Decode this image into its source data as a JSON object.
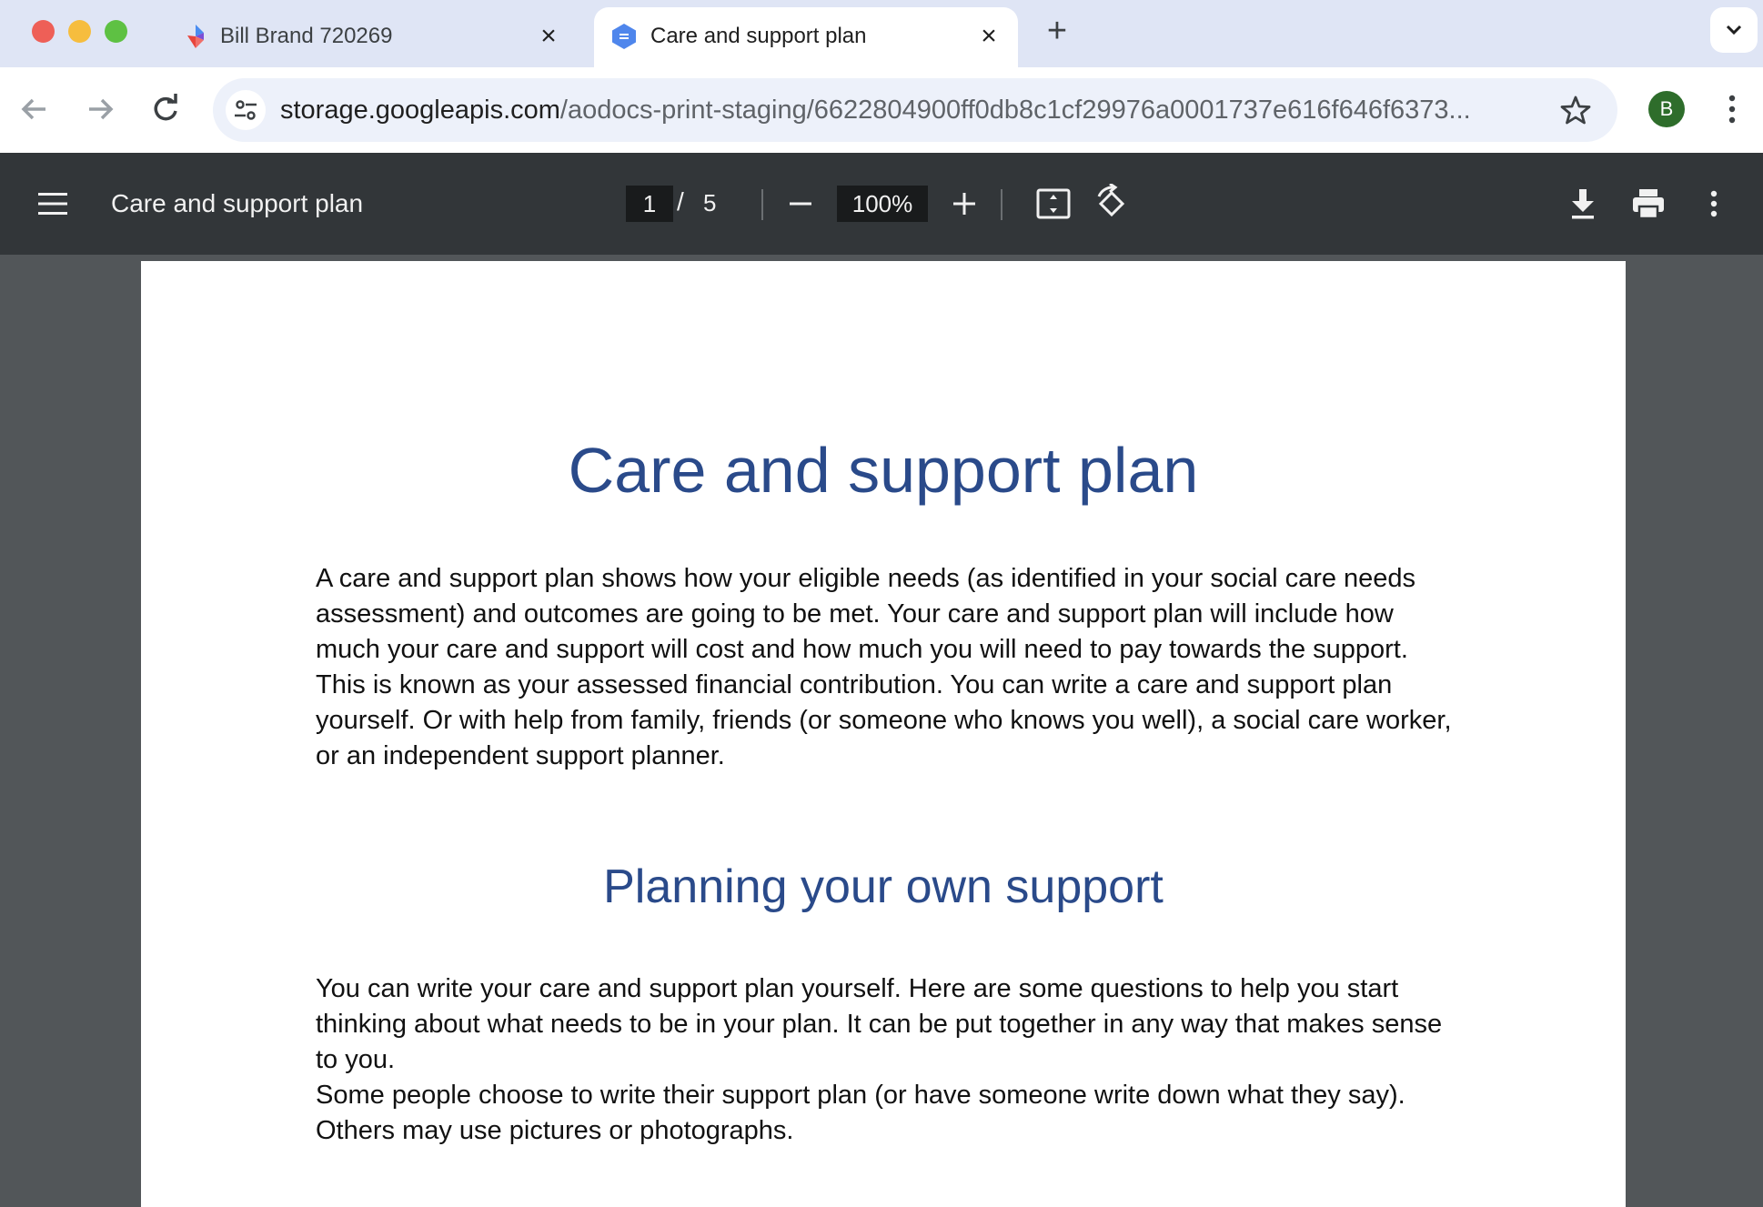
{
  "browser": {
    "tabs": [
      {
        "title": "Bill Brand 720269",
        "favicon": "aodocs-icon",
        "active": false
      },
      {
        "title": "Care and support plan",
        "favicon": "google-docs-icon",
        "active": true
      }
    ],
    "new_tab_label": "+",
    "url_host": "storage.googleapis.com",
    "url_path": "/aodocs-print-staging/6622804900ff0db8c1cf29976a0001737e616f646f6373...",
    "profile_initial": "B"
  },
  "pdf_viewer": {
    "title": "Care and support plan",
    "current_page": "1",
    "page_separator": "/",
    "total_pages": "5",
    "zoom": "100%"
  },
  "document": {
    "heading": "Care and support plan",
    "paragraph1": "A care and support plan shows how your eligible needs (as identified in your social care needs assessment) and outcomes are going to be met. Your care and support plan will include how much your care and support will cost and how much you will need to pay towards the support. This is known as your assessed financial contribution. You can write a care and support plan yourself. Or with help from family, friends (or someone who knows you well), a social care worker, or an independent support planner.",
    "subheading": "Planning your own support",
    "paragraph2": "You can write your care and support plan yourself. Here are some questions to help you start thinking about what needs to be in your plan. It can be put together in any way that makes sense to you.",
    "paragraph3": "Some people choose to write their support plan (or have someone write down what they say). Others may use pictures or photographs."
  },
  "colors": {
    "heading": "#2a4a8a",
    "pdf_toolbar": "#323639",
    "viewer_background": "#525659",
    "tabstrip": "#dfe5f5"
  }
}
